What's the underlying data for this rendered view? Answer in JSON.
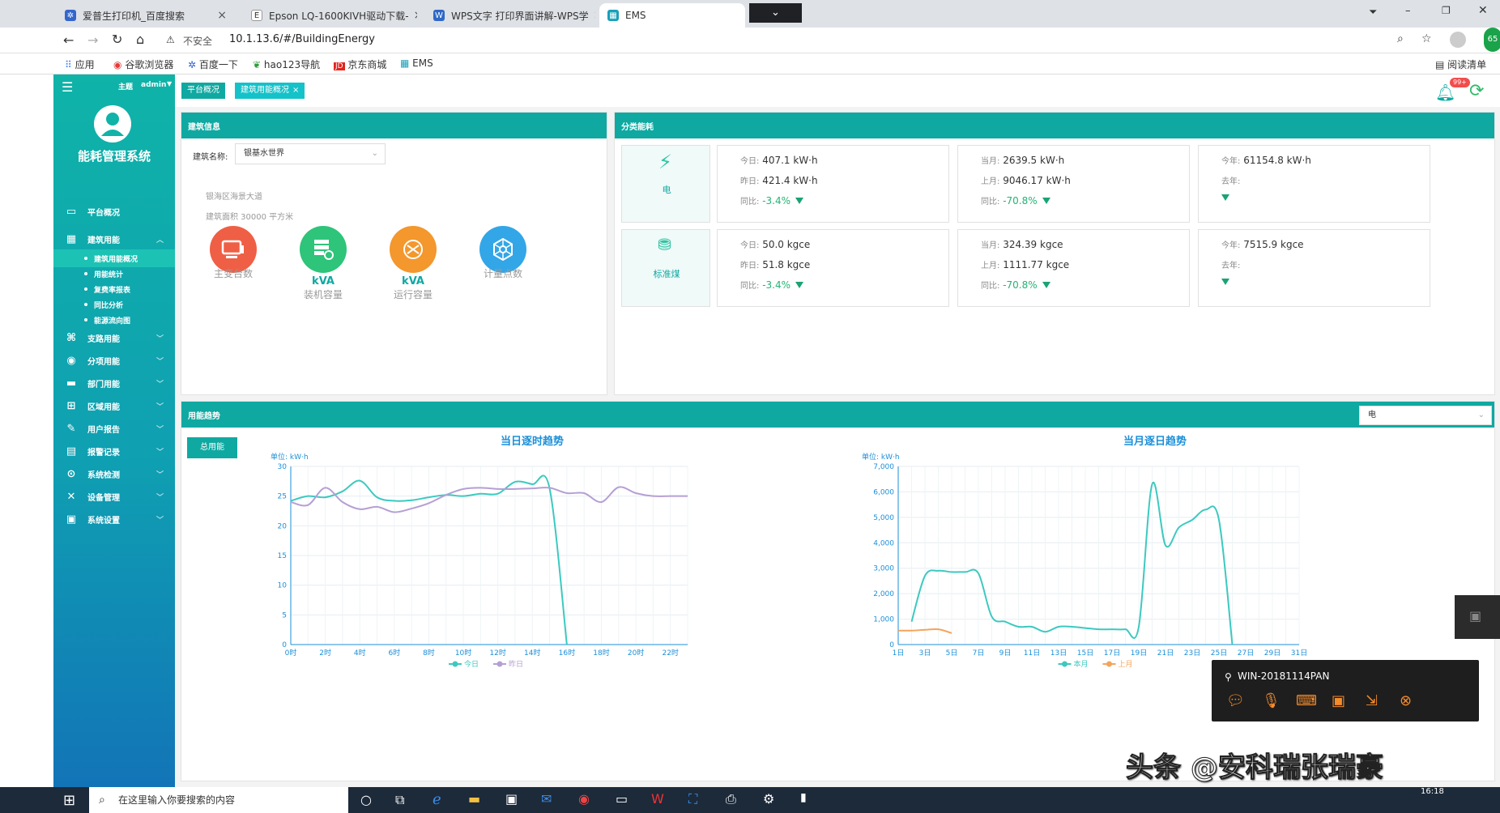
{
  "browser": {
    "tabs": [
      {
        "title": "爱普生打印机_百度搜索"
      },
      {
        "title": "Epson LQ-1600KIVH驱动下载-"
      },
      {
        "title": "WPS文字 打印界面讲解-WPS学"
      },
      {
        "title": "EMS"
      }
    ],
    "security": "不安全",
    "url": "10.1.13.6/#/BuildingEnergy",
    "bookmarks": [
      "应用",
      "谷歌浏览器",
      "百度一下",
      "hao123导航",
      "京东商城",
      "EMS"
    ],
    "reading_list": "阅读清单",
    "profile_badge": "65"
  },
  "app": {
    "header": {
      "theme_label": "主题",
      "user": "admin",
      "notify_badge": "99+"
    },
    "tags": [
      {
        "label": "平台概况"
      },
      {
        "label": "建筑用能概况"
      }
    ],
    "system_name": "能耗管理系统",
    "menu": [
      {
        "label": "平台概况",
        "icon": "monitor-icon"
      },
      {
        "label": "建筑用能",
        "icon": "building-icon"
      },
      {
        "label": "支路用能",
        "icon": "branch-icon"
      },
      {
        "label": "分项用能",
        "icon": "compass-icon"
      },
      {
        "label": "部门用能",
        "icon": "folder-icon"
      },
      {
        "label": "区域用能",
        "icon": "grid-icon"
      },
      {
        "label": "用户报告",
        "icon": "edit-icon"
      },
      {
        "label": "报警记录",
        "icon": "document-icon"
      },
      {
        "label": "系统检测",
        "icon": "location-icon"
      },
      {
        "label": "设备管理",
        "icon": "tools-icon"
      },
      {
        "label": "系统设置",
        "icon": "settings-icon"
      }
    ],
    "submenu": [
      "建筑用能概况",
      "用能统计",
      "复费率报表",
      "同比分析",
      "能源流向图"
    ],
    "building_info": {
      "title": "建筑信息",
      "name_label": "建筑名称:",
      "name_value": "银基水世界",
      "address": "银海区海景大道",
      "area": "建筑面积 30000 平方米",
      "stats": [
        {
          "value": "",
          "label": "主变台数",
          "color": "#ef5f45"
        },
        {
          "value": "kVA",
          "label": "装机容量",
          "color": "#2ec47a"
        },
        {
          "value": "kVA",
          "label": "运行容量",
          "color": "#f4972c"
        },
        {
          "value": "",
          "label": "计量点数",
          "color": "#33a6e8"
        }
      ]
    },
    "category": {
      "title": "分类能耗",
      "rows": [
        {
          "name": "电",
          "icon": "lightning-icon",
          "today_label": "今日:",
          "today": "407.1 kW·h",
          "yesterday_label": "昨日:",
          "yesterday": "421.4 kW·h",
          "day_yoy_label": "同比:",
          "day_yoy": "-3.4%",
          "month_label": "当月:",
          "month": "2639.5 kW·h",
          "last_month_label": "上月:",
          "last_month": "9046.17 kW·h",
          "month_yoy_label": "同比:",
          "month_yoy": "-70.8%",
          "year_label": "今年:",
          "year": "61154.8 kW·h",
          "last_year_label": "去年:"
        },
        {
          "name": "标准煤",
          "icon": "coal-icon",
          "today_label": "今日:",
          "today": "50.0 kgce",
          "yesterday_label": "昨日:",
          "yesterday": "51.8 kgce",
          "day_yoy_label": "同比:",
          "day_yoy": "-3.4%",
          "month_label": "当月:",
          "month": "324.39 kgce",
          "last_month_label": "上月:",
          "last_month": "1111.77 kgce",
          "month_yoy_label": "同比:",
          "month_yoy": "-70.8%",
          "year_label": "今年:",
          "year": "7515.9 kgce",
          "last_year_label": "去年:"
        }
      ]
    },
    "trend": {
      "title": "用能趋势",
      "select_value": "电",
      "total_button": "总用能",
      "chart1_title": "当日逐时趋势",
      "chart2_title": "当月逐日趋势",
      "unit_label": "单位: kW·h"
    }
  },
  "chart_data": [
    {
      "type": "line",
      "title": "当日逐时趋势",
      "ylabel": "单位: kW·h",
      "ylim": [
        0,
        30
      ],
      "yticks": [
        0,
        5,
        10,
        15,
        20,
        25,
        30
      ],
      "x": [
        "0时",
        "1时",
        "2时",
        "3时",
        "4时",
        "5时",
        "6时",
        "7时",
        "8时",
        "9时",
        "10时",
        "11时",
        "12时",
        "13时",
        "14时",
        "15时",
        "16时",
        "17时",
        "18时",
        "19时",
        "20时",
        "21时",
        "22时",
        "23时"
      ],
      "xtick_labels": [
        "0时",
        "2时",
        "4时",
        "6时",
        "8时",
        "10时",
        "12时",
        "14时",
        "16时",
        "18时",
        "20时",
        "22时"
      ],
      "series": [
        {
          "name": "今日",
          "color": "#3cc9c0",
          "values": [
            24.2,
            25.0,
            24.8,
            25.8,
            27.6,
            24.8,
            24.2,
            24.3,
            24.8,
            25.2,
            25.0,
            25.4,
            25.4,
            27.4,
            27.0,
            26.3,
            0
          ]
        },
        {
          "name": "昨日",
          "color": "#b59fd4",
          "values": [
            24.0,
            23.5,
            26.4,
            24.0,
            22.8,
            23.2,
            22.3,
            22.9,
            23.8,
            25.2,
            26.2,
            26.4,
            26.2,
            26.2,
            26.3,
            26.4,
            25.5,
            25.5,
            24.0,
            26.5,
            25.5,
            25.0,
            25.0,
            25.0
          ]
        }
      ],
      "legend": "bottom"
    },
    {
      "type": "line",
      "title": "当月逐日趋势",
      "ylabel": "单位: kW·h",
      "ylim": [
        0,
        7000
      ],
      "yticks": [
        0,
        1000,
        2000,
        3000,
        4000,
        5000,
        6000,
        7000
      ],
      "ytick_labels": [
        "0",
        "1,000",
        "2,000",
        "3,000",
        "4,000",
        "5,000",
        "6,000",
        "7,000"
      ],
      "x": [
        "1日",
        "2日",
        "3日",
        "4日",
        "5日",
        "6日",
        "7日",
        "8日",
        "9日",
        "10日",
        "11日",
        "12日",
        "13日",
        "14日",
        "15日",
        "16日",
        "17日",
        "18日",
        "19日",
        "20日",
        "21日",
        "22日",
        "23日",
        "24日",
        "25日",
        "26日",
        "27日",
        "28日",
        "29日",
        "30日",
        "31日"
      ],
      "xtick_labels": [
        "1日",
        "3日",
        "5日",
        "7日",
        "9日",
        "11日",
        "13日",
        "15日",
        "17日",
        "19日",
        "21日",
        "23日",
        "25日",
        "27日",
        "29日",
        "31日"
      ],
      "series": [
        {
          "name": "本月",
          "color": "#3cc9c0",
          "values": [
            null,
            900,
            2700,
            2900,
            2850,
            2850,
            2800,
            1100,
            900,
            700,
            700,
            500,
            700,
            700,
            650,
            600,
            600,
            600,
            700,
            6300,
            3900,
            4600,
            4900,
            5300,
            4900,
            0
          ]
        },
        {
          "name": "上月",
          "color": "#f4a45c",
          "values": [
            550,
            550,
            580,
            600,
            450
          ]
        }
      ],
      "legend": "bottom"
    }
  ],
  "taskbar": {
    "search_placeholder": "在这里输入你要搜索的内容",
    "time": "16:18"
  },
  "overlay": {
    "remote_name": "WIN-20181114PAN",
    "watermark": "头条 @安科瑞张瑞豪"
  }
}
